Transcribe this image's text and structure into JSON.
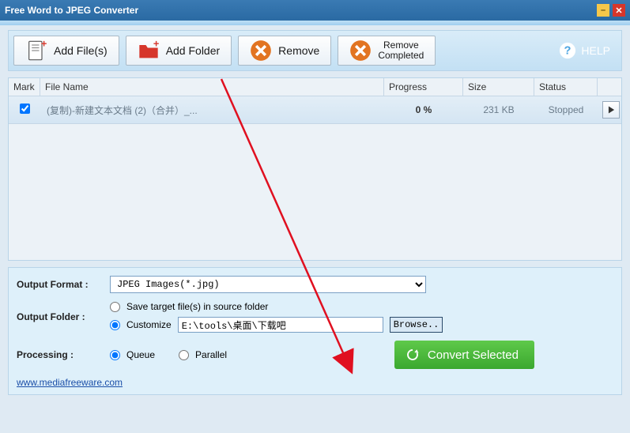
{
  "window": {
    "title": "Free Word to JPEG Converter"
  },
  "toolbar": {
    "add_files": "Add File(s)",
    "add_folder": "Add Folder",
    "remove": "Remove",
    "remove_completed_l1": "Remove",
    "remove_completed_l2": "Completed",
    "help": "HELP"
  },
  "grid": {
    "headers": {
      "mark": "Mark",
      "file": "File Name",
      "progress": "Progress",
      "size": "Size",
      "status": "Status"
    },
    "rows": [
      {
        "checked": true,
        "file": "(复制)-新建文本文档 (2)（合并）_...",
        "progress": "0 %",
        "size": "231 KB",
        "status": "Stopped"
      }
    ]
  },
  "output": {
    "format_label": "Output Format :",
    "format_value": "JPEG Images(*.jpg)",
    "folder_label": "Output Folder :",
    "opt_source": "Save target file(s) in source folder",
    "opt_customize": "Customize",
    "path_value": "E:\\tools\\桌面\\下载吧",
    "browse": "Browse..",
    "processing_label": "Processing :",
    "opt_queue": "Queue",
    "opt_parallel": "Parallel"
  },
  "convert_label": "Convert Selected",
  "footer_url": "www.mediafreeware.com"
}
